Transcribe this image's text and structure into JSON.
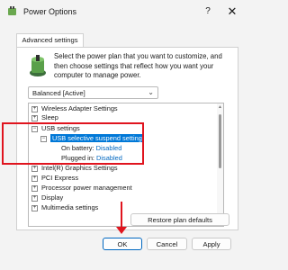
{
  "window": {
    "title": "Power Options",
    "help_label": "?",
    "close_label": "✕"
  },
  "tab": {
    "label": "Advanced settings"
  },
  "description": "Select the power plan that you want to customize, and then choose settings that reflect how you want your computer to manage power.",
  "plan_select": {
    "value": "Balanced [Active]"
  },
  "tree": {
    "items": [
      {
        "toggle": "+",
        "label": "Wireless Adapter Settings"
      },
      {
        "toggle": "+",
        "label": "Sleep"
      },
      {
        "toggle": "−",
        "label": "USB settings"
      },
      {
        "toggle": "−",
        "label": "USB selective suspend setting"
      },
      {
        "label": "On battery:",
        "value": "Disabled"
      },
      {
        "label": "Plugged in:",
        "value": "Disabled"
      },
      {
        "toggle": "+",
        "label": "Intel(R) Graphics Settings"
      },
      {
        "toggle": "+",
        "label": "PCI Express"
      },
      {
        "toggle": "+",
        "label": "Processor power management"
      },
      {
        "toggle": "+",
        "label": "Display"
      },
      {
        "toggle": "+",
        "label": "Multimedia settings"
      }
    ]
  },
  "buttons": {
    "restore": "Restore plan defaults",
    "ok": "OK",
    "cancel": "Cancel",
    "apply": "Apply"
  },
  "colors": {
    "accent": "#0078d7",
    "annotation": "#e0141e"
  }
}
